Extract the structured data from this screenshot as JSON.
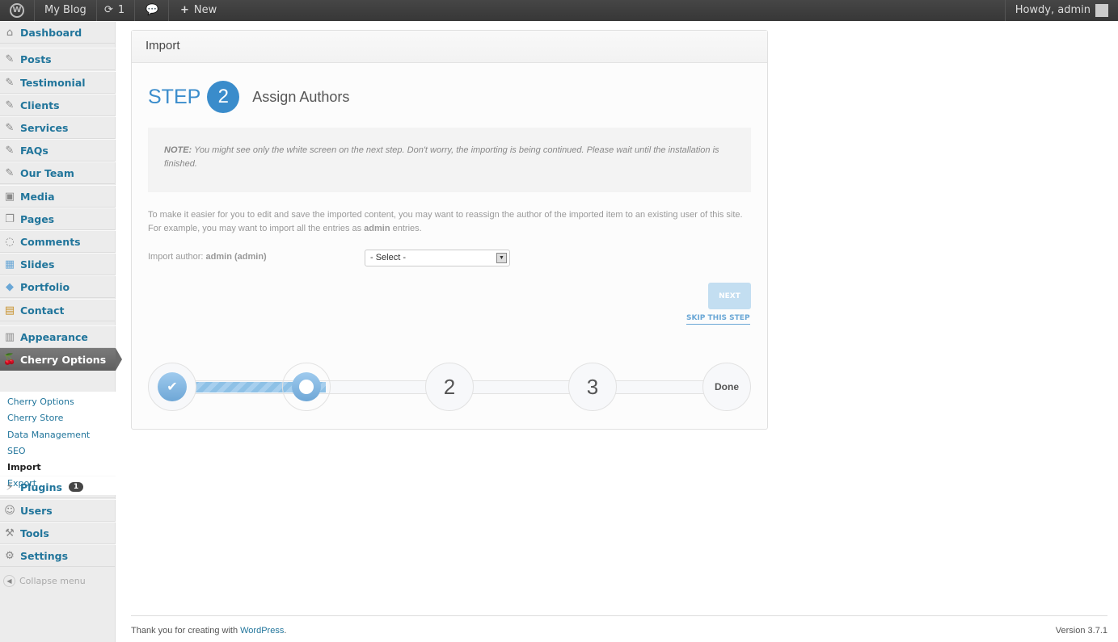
{
  "adminbar": {
    "site": "My Blog",
    "updates": "1",
    "new": "New",
    "howdy": "Howdy, admin"
  },
  "menu": {
    "dashboard": "Dashboard",
    "posts": "Posts",
    "testimonial": "Testimonial",
    "clients": "Clients",
    "services": "Services",
    "faqs": "FAQs",
    "team": "Our Team",
    "media": "Media",
    "pages": "Pages",
    "comments": "Comments",
    "slides": "Slides",
    "portfolio": "Portfolio",
    "contact": "Contact",
    "appearance": "Appearance",
    "cherry": "Cherry Options",
    "plugins": "Plugins",
    "plugins_badge": "1",
    "users": "Users",
    "tools": "Tools",
    "settings": "Settings",
    "collapse": "Collapse menu"
  },
  "submenu": [
    "Cherry Options",
    "Cherry Store",
    "Data Management",
    "SEO",
    "Import",
    "Export"
  ],
  "panel": {
    "title": "Import",
    "step_label": "STEP",
    "step_num": "2",
    "step_title": "Assign Authors",
    "note_bold": "NOTE:",
    "note": " You might see only the white screen on the next step. Don't worry, the importing is being continued. Please wait until the installation is finished.",
    "para1": "To make it easier for you to edit and save the imported content, you may want to reassign the author of the imported item to an existing user of this site. For example, you may want to import all the entries as ",
    "para_bold": "admin",
    "para2": " entries.",
    "author_label": "Import author: ",
    "author_name": "admin (admin)",
    "select_value": "- Select -",
    "next": "NEXT",
    "skip": "SKIP THIS STEP",
    "progress": {
      "n2": "2",
      "n3": "3",
      "done": "Done"
    }
  },
  "footer": {
    "thanks": "Thank you for creating with ",
    "link": "WordPress",
    "dot": ".",
    "version": "Version 3.7.1"
  }
}
